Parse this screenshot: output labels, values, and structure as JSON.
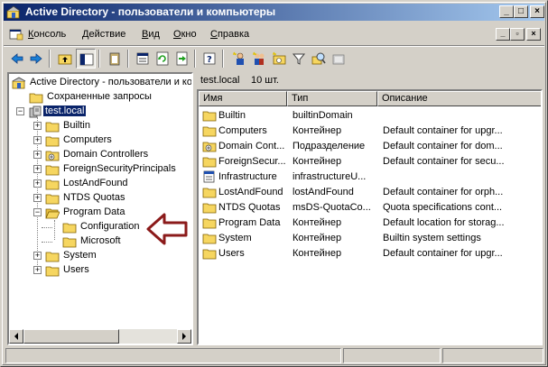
{
  "window": {
    "title": "Active Directory - пользователи и компьютеры"
  },
  "menu": [
    {
      "label": "Консоль",
      "accel": "К",
      "rest": "онсоль"
    },
    {
      "label": "Действие",
      "accel": "Д",
      "rest": "ействие"
    },
    {
      "label": "Вид",
      "accel": "В",
      "rest": "ид"
    },
    {
      "label": "Окно",
      "accel": "О",
      "rest": "кно"
    },
    {
      "label": "Справка",
      "accel": "С",
      "rest": "правка"
    }
  ],
  "tree": {
    "root": "Active Directory - пользователи и компьютеры",
    "saved_queries": "Сохраненные запросы",
    "domain": "test.local",
    "items": [
      {
        "label": "Builtin",
        "type": "folder",
        "expander": "+"
      },
      {
        "label": "Computers",
        "type": "folder",
        "expander": "+"
      },
      {
        "label": "Domain Controllers",
        "type": "ou",
        "expander": "+"
      },
      {
        "label": "ForeignSecurityPrincipals",
        "type": "folder",
        "expander": "+"
      },
      {
        "label": "LostAndFound",
        "type": "folder",
        "expander": "+"
      },
      {
        "label": "NTDS Quotas",
        "type": "folder",
        "expander": "+"
      },
      {
        "label": "Program Data",
        "type": "folder-open",
        "expander": "−"
      },
      {
        "label": "Configuration",
        "type": "folder",
        "expander": ""
      },
      {
        "label": "Microsoft",
        "type": "folder",
        "expander": ""
      },
      {
        "label": "System",
        "type": "folder",
        "expander": "+"
      },
      {
        "label": "Users",
        "type": "folder",
        "expander": "+"
      }
    ]
  },
  "list_header": {
    "title": "test.local",
    "count": "10 шт."
  },
  "columns": [
    "Имя",
    "Тип",
    "Описание"
  ],
  "rows": [
    {
      "name": "Builtin",
      "type": "builtinDomain",
      "desc": "",
      "icon": "folder"
    },
    {
      "name": "Computers",
      "type": "Контейнер",
      "desc": "Default container for upgr...",
      "icon": "folder"
    },
    {
      "name": "Domain Cont...",
      "type": "Подразделение",
      "desc": "Default container for dom...",
      "icon": "ou"
    },
    {
      "name": "ForeignSecur...",
      "type": "Контейнер",
      "desc": "Default container for secu...",
      "icon": "folder"
    },
    {
      "name": "Infrastructure",
      "type": "infrastructureU...",
      "desc": "",
      "icon": "infra"
    },
    {
      "name": "LostAndFound",
      "type": "lostAndFound",
      "desc": "Default container for orph...",
      "icon": "folder"
    },
    {
      "name": "NTDS Quotas",
      "type": "msDS-QuotaCo...",
      "desc": "Quota specifications cont...",
      "icon": "folder"
    },
    {
      "name": "Program Data",
      "type": "Контейнер",
      "desc": "Default location for storag...",
      "icon": "folder"
    },
    {
      "name": "System",
      "type": "Контейнер",
      "desc": "Builtin system settings",
      "icon": "folder"
    },
    {
      "name": "Users",
      "type": "Контейнер",
      "desc": "Default container for upgr...",
      "icon": "folder"
    }
  ],
  "colors": {
    "title_start": "#0a246a",
    "title_end": "#a6caf0",
    "folder": "#f6d660",
    "arrow": "#8b1a1a"
  }
}
